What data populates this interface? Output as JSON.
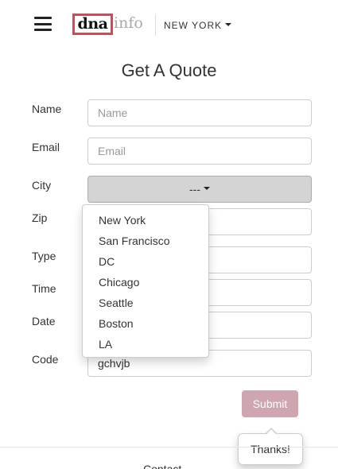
{
  "header": {
    "logo_dna": "dna",
    "logo_info": "info",
    "city": "NEW YORK"
  },
  "page_title": "Get A Quote",
  "form": {
    "name": {
      "label": "Name",
      "placeholder": "Name",
      "value": ""
    },
    "email": {
      "label": "Email",
      "placeholder": "Email",
      "value": ""
    },
    "city": {
      "label": "City",
      "selected": "---"
    },
    "zip": {
      "label": "Zip"
    },
    "type": {
      "label": "Type"
    },
    "time": {
      "label": "Time"
    },
    "date": {
      "label": "Date"
    },
    "code": {
      "label": "Code",
      "value": "gchvjb"
    }
  },
  "city_options": [
    "New York",
    "San Francisco",
    "DC",
    "Chicago",
    "Seattle",
    "Boston",
    "LA"
  ],
  "submit_label": "Submit",
  "popover_text": "Thanks!",
  "footer_text": "Contact",
  "colors": {
    "logo_border": "#e4404d",
    "submit_bg": "#cfa5b0"
  },
  "icons": {
    "menu": "hamburger-icon",
    "caret": "caret-down-icon"
  }
}
